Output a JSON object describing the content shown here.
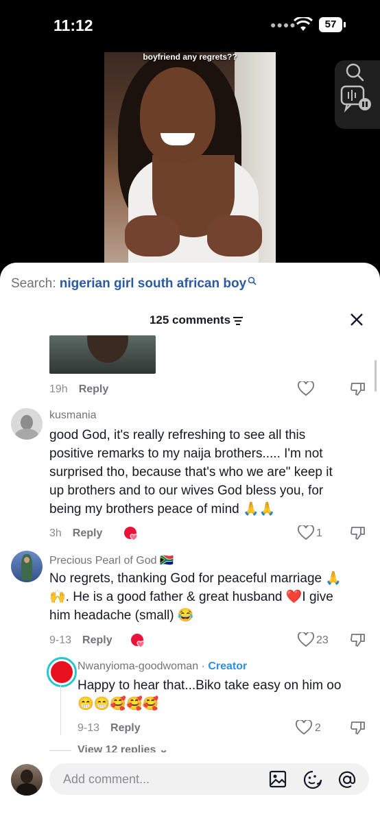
{
  "status_bar": {
    "time": "11:12",
    "battery": "57"
  },
  "video": {
    "caption": "boyfriend any regrets??"
  },
  "search": {
    "prefix": "Search: ",
    "query": "nigerian girl south african boy"
  },
  "comments_header": {
    "count_label": "125 comments"
  },
  "comments": [
    {
      "time": "19h",
      "reply_label": "Reply"
    },
    {
      "username": "kusmania",
      "lines": [
        "good God, it's really refreshing to see all this",
        "positive remarks to my naija brothers..... I'm not",
        "surprised tho, because that's who we are\" keep it",
        "up brothers and to our wives God bless you, for",
        "being my brothers peace of mind 🙏🙏"
      ],
      "time": "3h",
      "reply_label": "Reply",
      "likes": "1",
      "creator_liked": true
    },
    {
      "username": "Precious Pearl of God 🇿🇦",
      "lines": [
        "No regrets, thanking God for peaceful marriage 🙏",
        "🙌. He is a good father & great husband ❤️I give",
        "him headache (small) 😂"
      ],
      "time": "9-13",
      "reply_label": "Reply",
      "likes": "23",
      "creator_liked": true
    }
  ],
  "reply": {
    "username": "Nwanyioma-goodwoman",
    "separator": " · ",
    "badge": "Creator",
    "lines": [
      "Happy to hear that...Biko take easy on him oo",
      "😁😁🥰🥰🥰"
    ],
    "time": "9-13",
    "reply_label": "Reply",
    "likes": "2"
  },
  "view_replies": "View 12 replies ⌄",
  "composer": {
    "placeholder": "Add comment..."
  },
  "colors": {
    "accent_blue": "#2b5aa3",
    "creator_blue": "#2e8fe0",
    "like_red": "#fe2c55"
  }
}
